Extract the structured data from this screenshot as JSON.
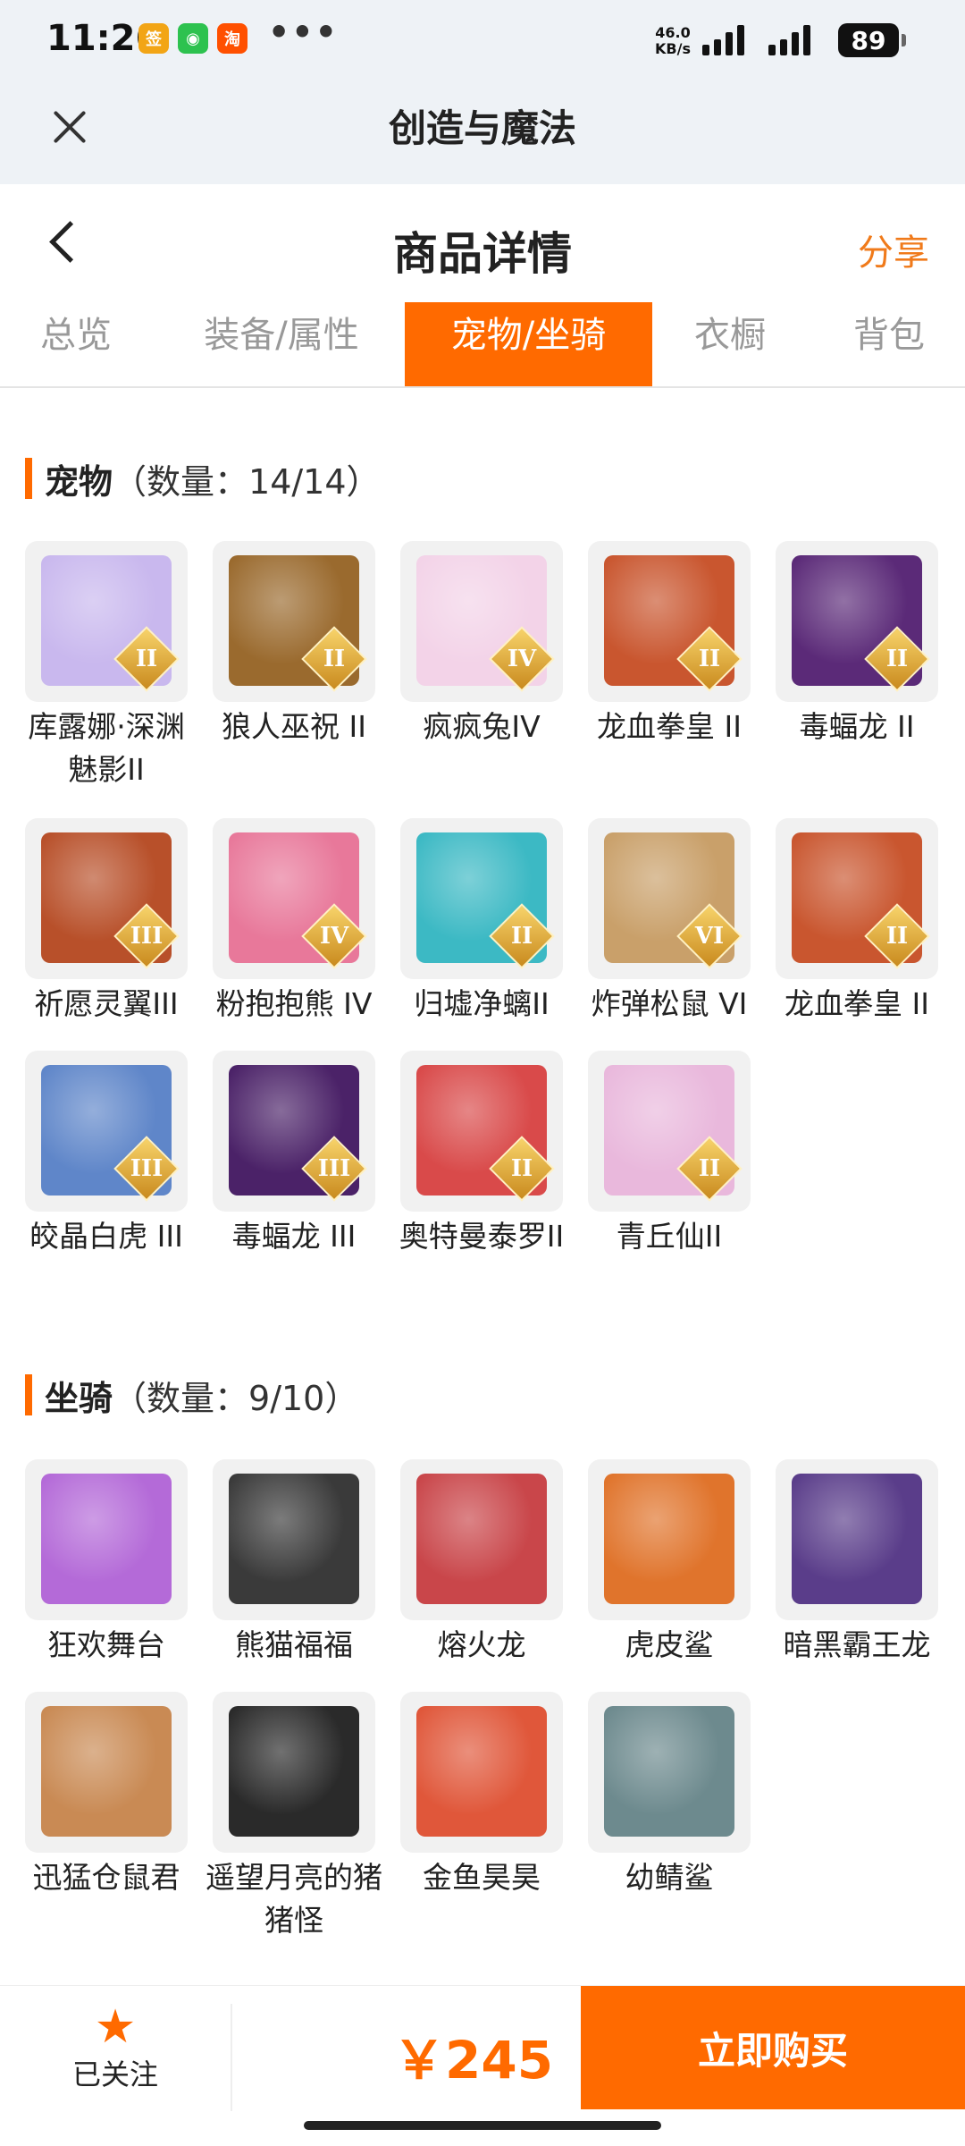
{
  "status_bar": {
    "time": "11:26",
    "more": "•••",
    "net_speed_value": "46.0",
    "net_speed_unit": "KB/s",
    "battery": "89",
    "apps": [
      {
        "icon": "lottery-app-icon",
        "color": "#f2a516",
        "glyph": "签"
      },
      {
        "icon": "wechat-icon",
        "color": "#2dc24f",
        "glyph": "◉"
      },
      {
        "icon": "taobao-icon",
        "color": "#ff5000",
        "glyph": "淘"
      }
    ]
  },
  "app_bar": {
    "title": "创造与魔法"
  },
  "page_header": {
    "title": "商品详情",
    "share_label": "分享"
  },
  "tabs": [
    {
      "label": "总览",
      "active": false
    },
    {
      "label": "装备/属性",
      "active": false
    },
    {
      "label": "宠物/坐骑",
      "active": true
    },
    {
      "label": "衣橱",
      "active": false
    },
    {
      "label": "背包",
      "active": false
    }
  ],
  "pets": {
    "title": "宠物",
    "count": "（数量：14/14）",
    "items": [
      {
        "name": "库露娜·深渊魅影II",
        "badge": "II",
        "color": "#c9b8ee"
      },
      {
        "name": "狼人巫祝 II",
        "badge": "II",
        "color": "#9a6a2e"
      },
      {
        "name": "疯疯兔IV",
        "badge": "IV",
        "color": "#f3d3e8"
      },
      {
        "name": "龙血拳皇 II",
        "badge": "II",
        "color": "#c9562f"
      },
      {
        "name": "毒蝠龙 II",
        "badge": "II",
        "color": "#5b2a78"
      },
      {
        "name": "祈愿灵翼III",
        "badge": "III",
        "color": "#b8502a"
      },
      {
        "name": "粉抱抱熊 IV",
        "badge": "IV",
        "color": "#e8789a"
      },
      {
        "name": "归墟净螭II",
        "badge": "II",
        "color": "#3cb9c4"
      },
      {
        "name": "炸弹松鼠 VI",
        "badge": "VI",
        "color": "#c9a06a"
      },
      {
        "name": "龙血拳皇 II",
        "badge": "II",
        "color": "#c9562f"
      },
      {
        "name": "皎晶白虎 III",
        "badge": "III",
        "color": "#5f86c9"
      },
      {
        "name": "毒蝠龙 III",
        "badge": "III",
        "color": "#4b2268"
      },
      {
        "name": "奥特曼泰罗II",
        "badge": "II",
        "color": "#d94a4a"
      },
      {
        "name": "青丘仙II",
        "badge": "II",
        "color": "#e9b8dc"
      }
    ]
  },
  "mounts": {
    "title": "坐骑",
    "count": "（数量：9/10）",
    "items": [
      {
        "name": "狂欢舞台",
        "color": "#b46ad8"
      },
      {
        "name": "熊猫福福",
        "color": "#3a3a3a"
      },
      {
        "name": "熔火龙",
        "color": "#c9464a"
      },
      {
        "name": "虎皮鲨",
        "color": "#e0742c"
      },
      {
        "name": "暗黑霸王龙",
        "color": "#5a3d8a"
      },
      {
        "name": "迅猛仓鼠君",
        "color": "#c98a54"
      },
      {
        "name": "遥望月亮的猪猪怪",
        "color": "#2a2a2a"
      },
      {
        "name": "金鱼昊昊",
        "color": "#e0573a"
      },
      {
        "name": "幼鲭鲨",
        "color": "#6d8a8e"
      }
    ]
  },
  "bottom_bar": {
    "follow_label": "已关注",
    "price": "￥245",
    "buy_label": "立即购买"
  },
  "colors": {
    "accent": "#ff6a00",
    "share": "#f07a1a",
    "header_bg": "#eef2f6"
  }
}
